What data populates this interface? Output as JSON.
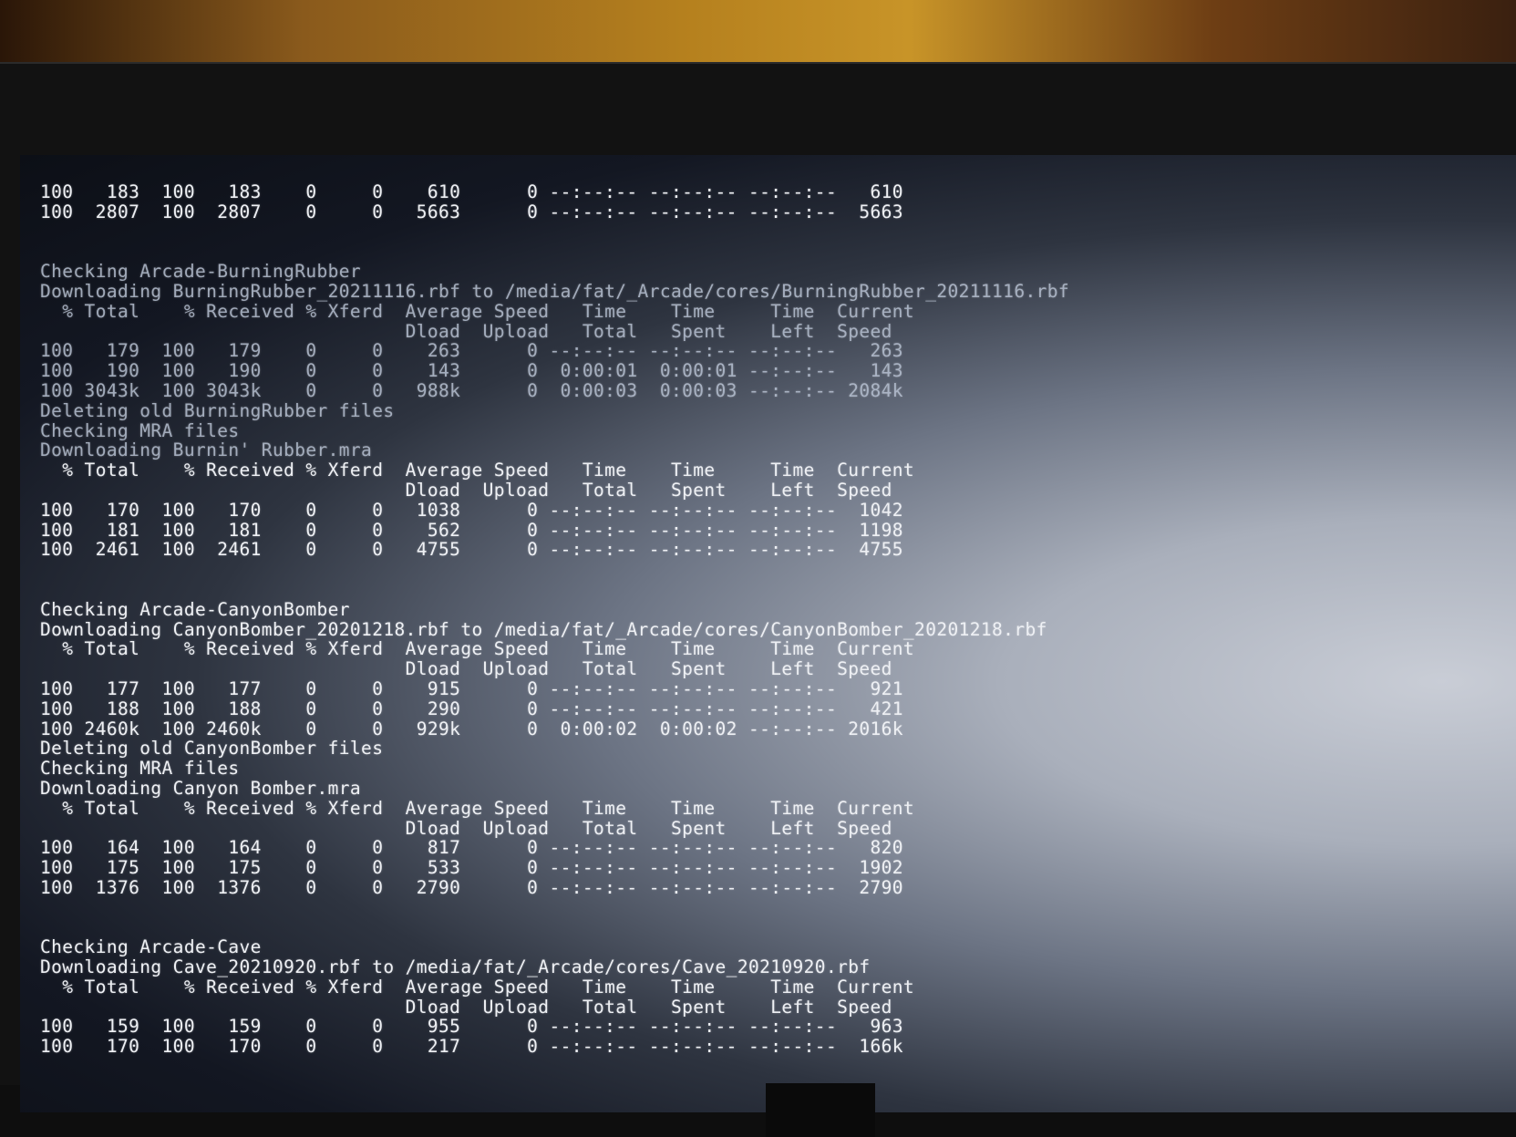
{
  "terminal": {
    "lines": [
      "100   183  100   183    0     0    610      0 --:--:-- --:--:-- --:--:--   610",
      "100  2807  100  2807    0     0   5663      0 --:--:-- --:--:-- --:--:--  5663",
      "",
      "",
      "Checking Arcade-BurningRubber",
      "Downloading BurningRubber_20211116.rbf to /media/fat/_Arcade/cores/BurningRubber_20211116.rbf",
      "  % Total    % Received % Xferd  Average Speed   Time    Time     Time  Current",
      "                                 Dload  Upload   Total   Spent    Left  Speed",
      "100   179  100   179    0     0    263      0 --:--:-- --:--:-- --:--:--   263",
      "100   190  100   190    0     0    143      0  0:00:01  0:00:01 --:--:--   143",
      "100 3043k  100 3043k    0     0   988k      0  0:00:03  0:00:03 --:--:-- 2084k",
      "Deleting old BurningRubber files",
      "Checking MRA files",
      "Downloading Burnin' Rubber.mra",
      "  % Total    % Received % Xferd  Average Speed   Time    Time     Time  Current",
      "                                 Dload  Upload   Total   Spent    Left  Speed",
      "100   170  100   170    0     0   1038      0 --:--:-- --:--:-- --:--:--  1042",
      "100   181  100   181    0     0    562      0 --:--:-- --:--:-- --:--:--  1198",
      "100  2461  100  2461    0     0   4755      0 --:--:-- --:--:-- --:--:--  4755",
      "",
      "",
      "Checking Arcade-CanyonBomber",
      "Downloading CanyonBomber_20201218.rbf to /media/fat/_Arcade/cores/CanyonBomber_20201218.rbf",
      "  % Total    % Received % Xferd  Average Speed   Time    Time     Time  Current",
      "                                 Dload  Upload   Total   Spent    Left  Speed",
      "100   177  100   177    0     0    915      0 --:--:-- --:--:-- --:--:--   921",
      "100   188  100   188    0     0    290      0 --:--:-- --:--:-- --:--:--   421",
      "100 2460k  100 2460k    0     0   929k      0  0:00:02  0:00:02 --:--:-- 2016k",
      "Deleting old CanyonBomber files",
      "Checking MRA files",
      "Downloading Canyon Bomber.mra",
      "  % Total    % Received % Xferd  Average Speed   Time    Time     Time  Current",
      "                                 Dload  Upload   Total   Spent    Left  Speed",
      "100   164  100   164    0     0    817      0 --:--:-- --:--:-- --:--:--   820",
      "100   175  100   175    0     0    533      0 --:--:-- --:--:-- --:--:--  1902",
      "100  1376  100  1376    0     0   2790      0 --:--:-- --:--:-- --:--:--  2790",
      "",
      "",
      "Checking Arcade-Cave",
      "Downloading Cave_20210920.rbf to /media/fat/_Arcade/cores/Cave_20210920.rbf",
      "  % Total    % Received % Xferd  Average Speed   Time    Time     Time  Current",
      "                                 Dload  Upload   Total   Spent    Left  Speed",
      "100   159  100   159    0     0    955      0 --:--:-- --:--:-- --:--:--   963",
      "100   170  100   170    0     0    217      0 --:--:-- --:--:-- --:--:--  166k"
    ]
  }
}
